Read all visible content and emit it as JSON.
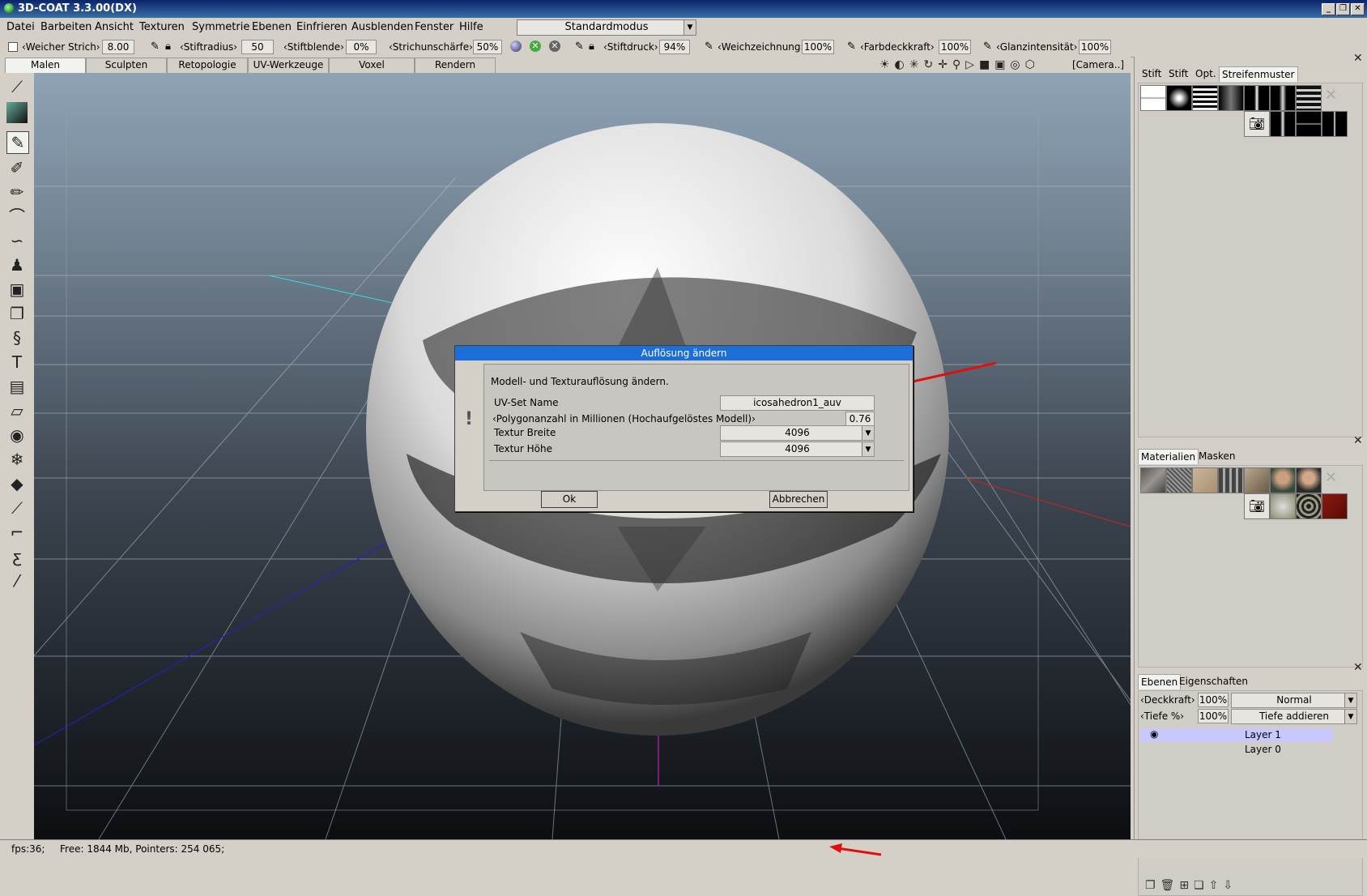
{
  "window": {
    "title": "3D-COAT 3.3.00(DX)",
    "minimize": "_",
    "restore": "❐",
    "close": "✕"
  },
  "menu": [
    "Datei",
    "Barbeiten",
    "Ansicht",
    "Texturen",
    "Symmetrie",
    "Ebenen",
    "Einfrieren",
    "Ausblenden",
    "Fenster",
    "Hilfe"
  ],
  "mode_select": {
    "value": "Standardmodus"
  },
  "toolbar": {
    "soft_stroke_label": "‹Weicher  Strich›",
    "soft_stroke_value": "8.00",
    "pen_radius_label": "‹Stiftradius›",
    "pen_radius_value": "50",
    "pen_blend_label": "‹Stiftblende›",
    "pen_blend_value": "0%",
    "stroke_sharpness_label": "‹Strichunschärfe›",
    "stroke_sharpness_value": "50%",
    "pen_pressure_label": "‹Stiftdruck›",
    "pen_pressure_value": "94%",
    "softening_label": "‹Weichzeichnung›",
    "softening_value": "100%",
    "color_opacity_label": "‹Farbdeckkraft›",
    "color_opacity_value": "100%",
    "gloss_label": "‹Glanzintensität›",
    "gloss_value": "100%"
  },
  "mode_tabs": [
    "Malen",
    "Sculpten",
    "Retopologie",
    "UV-Werkzeuge",
    "Voxel",
    "Rendern"
  ],
  "camera_label": "[Camera..]",
  "right_panel": {
    "top_tabs": [
      "Stift",
      "Stift",
      "Opt.",
      "Streifenmuster"
    ],
    "mid_tabs": [
      "Materialien",
      "Masken"
    ],
    "layer_tabs": [
      "Ebenen",
      "Eigenschaften"
    ],
    "opacity_label": "‹Deckkraft›",
    "opacity_value": "100%",
    "blend_mode": "Normal",
    "depth_label": "‹Tiefe %›",
    "depth_value": "100%",
    "depth_mode": "Tiefe addieren",
    "layers": [
      "Layer 1",
      "Layer 0"
    ]
  },
  "dialog": {
    "title": "Auflösung ändern",
    "description": "Modell- und Texturauflösung ändern.",
    "uvset_label": "UV-Set Name",
    "uvset_value": "icosahedron1_auv",
    "poly_label": "‹Polygonanzahl in Millionen (Hochaufgelöstes Modell)›",
    "poly_value": "0.76",
    "tex_width_label": "Textur Breite",
    "tex_width_value": "4096",
    "tex_height_label": "Textur Höhe",
    "tex_height_value": "4096",
    "ok": "Ok",
    "cancel": "Abbrechen",
    "warning_glyph": "!"
  },
  "status": {
    "fps": "fps:36;",
    "memory": "Free: 1844 Mb, Pointers: 254 065;"
  },
  "colors": {
    "title_bar": "#0a246a",
    "dialog_title": "#1c6fd8",
    "arrow": "#e01010",
    "layer_selected": "#c8c8ff"
  }
}
